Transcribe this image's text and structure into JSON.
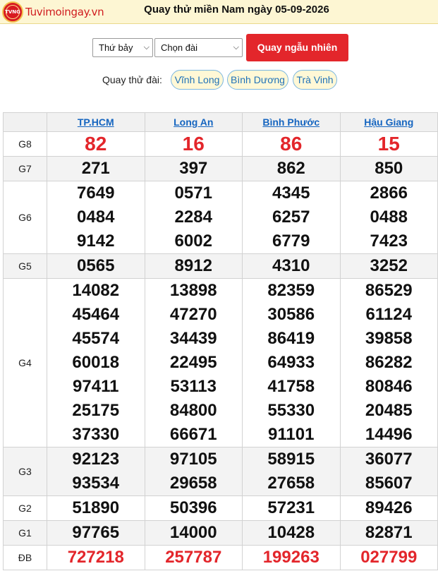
{
  "header": {
    "logo_text": "Tuvimoingay.vn",
    "logo_badge": "TVNG",
    "title": "Quay thử miền Nam ngày 05-09-2026"
  },
  "controls": {
    "day_select": "Thứ bảy",
    "station_select": "Chọn đài",
    "random_button": "Quay ngẫu nhiên"
  },
  "trial": {
    "label": "Quay thử đài:",
    "stations": [
      "Vĩnh Long",
      "Bình Dương",
      "Trà Vinh"
    ]
  },
  "table": {
    "columns": [
      "TP.HCM",
      "Long An",
      "Bình Phước",
      "Hậu Giang"
    ],
    "prizes": [
      {
        "label": "G8",
        "values": [
          [
            "82"
          ],
          [
            "16"
          ],
          [
            "86"
          ],
          [
            "15"
          ]
        ]
      },
      {
        "label": "G7",
        "values": [
          [
            "271"
          ],
          [
            "397"
          ],
          [
            "862"
          ],
          [
            "850"
          ]
        ]
      },
      {
        "label": "G6",
        "values": [
          [
            "7649",
            "0484",
            "9142"
          ],
          [
            "0571",
            "2284",
            "6002"
          ],
          [
            "4345",
            "6257",
            "6779"
          ],
          [
            "2866",
            "0488",
            "7423"
          ]
        ]
      },
      {
        "label": "G5",
        "values": [
          [
            "0565"
          ],
          [
            "8912"
          ],
          [
            "4310"
          ],
          [
            "3252"
          ]
        ]
      },
      {
        "label": "G4",
        "values": [
          [
            "14082",
            "45464",
            "45574",
            "60018",
            "97411",
            "25175",
            "37330"
          ],
          [
            "13898",
            "47270",
            "34439",
            "22495",
            "53113",
            "84800",
            "66671"
          ],
          [
            "82359",
            "30586",
            "86419",
            "64933",
            "41758",
            "55330",
            "91101"
          ],
          [
            "86529",
            "61124",
            "39858",
            "86282",
            "80846",
            "20485",
            "14496"
          ]
        ]
      },
      {
        "label": "G3",
        "values": [
          [
            "92123",
            "93534"
          ],
          [
            "97105",
            "29658"
          ],
          [
            "58915",
            "27658"
          ],
          [
            "36077",
            "85607"
          ]
        ]
      },
      {
        "label": "G2",
        "values": [
          [
            "51890"
          ],
          [
            "50396"
          ],
          [
            "57231"
          ],
          [
            "89426"
          ]
        ]
      },
      {
        "label": "G1",
        "values": [
          [
            "97765"
          ],
          [
            "14000"
          ],
          [
            "10428"
          ],
          [
            "82871"
          ]
        ]
      },
      {
        "label": "ĐB",
        "values": [
          [
            "727218"
          ],
          [
            "257787"
          ],
          [
            "199263"
          ],
          [
            "027799"
          ]
        ]
      }
    ]
  },
  "colors": {
    "accent_red": "#e3262b",
    "link_blue": "#1565c0",
    "header_bg": "#fdf6d3"
  }
}
